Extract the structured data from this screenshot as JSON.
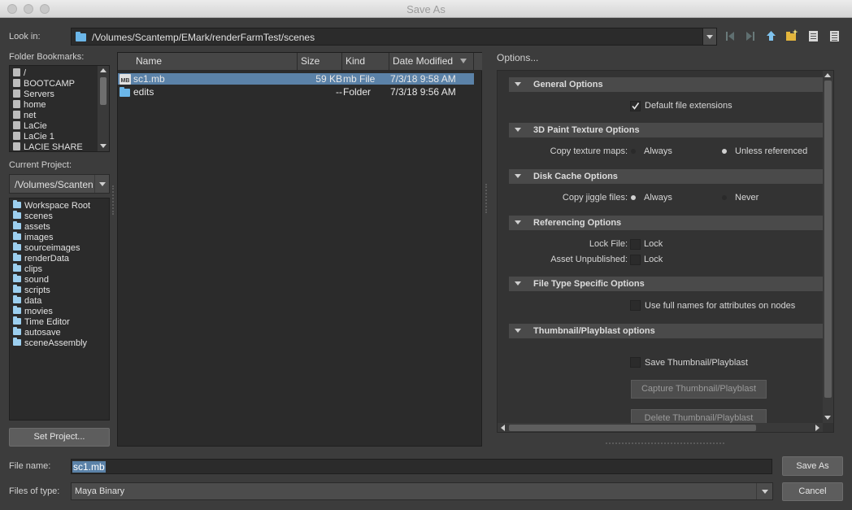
{
  "window": {
    "title": "Save As"
  },
  "lookin": {
    "label": "Look in:",
    "path": "/Volumes/Scantemp/EMark/renderFarmTest/scenes"
  },
  "toolbar_icons": [
    "back-icon",
    "forward-icon",
    "up-folder-icon",
    "new-folder-icon",
    "list-view-icon",
    "detail-view-icon"
  ],
  "bookmarks": {
    "label": "Folder Bookmarks:",
    "items": [
      "/",
      "BOOTCAMP",
      "Servers",
      "home",
      "net",
      "LaCie",
      "LaCie 1",
      "LACIE SHARE"
    ]
  },
  "project": {
    "label": "Current Project:",
    "value": "/Volumes/Scanten"
  },
  "workspace": {
    "items": [
      "Workspace Root",
      "scenes",
      "assets",
      "images",
      "sourceimages",
      "renderData",
      "clips",
      "sound",
      "scripts",
      "data",
      "movies",
      "Time Editor",
      "autosave",
      "sceneAssembly"
    ]
  },
  "set_project_label": "Set Project...",
  "filelist": {
    "columns": [
      "Name",
      "Size",
      "Kind",
      "Date Modified"
    ],
    "rows": [
      {
        "name": "sc1.mb",
        "icon_text": "MB",
        "size": "59 KB",
        "kind": "mb File",
        "date": "7/3/18 9:58 AM",
        "selected": true
      },
      {
        "name": "edits",
        "size": "--",
        "kind": "Folder",
        "date": "7/3/18 9:56 AM",
        "selected": false
      }
    ]
  },
  "options": {
    "title": "Options...",
    "general": {
      "title": "General Options",
      "default_ext": "Default file extensions"
    },
    "paint": {
      "title": "3D Paint Texture Options",
      "label": "Copy texture maps:",
      "opt1": "Always",
      "opt2": "Unless referenced"
    },
    "disk": {
      "title": "Disk Cache Options",
      "label": "Copy jiggle files:",
      "opt1": "Always",
      "opt2": "Never"
    },
    "ref": {
      "title": "Referencing Options",
      "lock_file": "Lock File:",
      "asset": "Asset Unpublished:",
      "lock": "Lock"
    },
    "filetype": {
      "title": "File Type Specific Options",
      "full_names": "Use full names for attributes on nodes"
    },
    "thumb": {
      "title": "Thumbnail/Playblast options",
      "save": "Save Thumbnail/Playblast",
      "capture": "Capture Thumbnail/Playblast",
      "delete": "Delete Thumbnail/Playblast"
    }
  },
  "bottom": {
    "filename_label": "File name:",
    "filename": "sc1.mb",
    "filetype_label": "Files of type:",
    "filetype": "Maya Binary",
    "save_label": "Save As",
    "cancel_label": "Cancel"
  }
}
